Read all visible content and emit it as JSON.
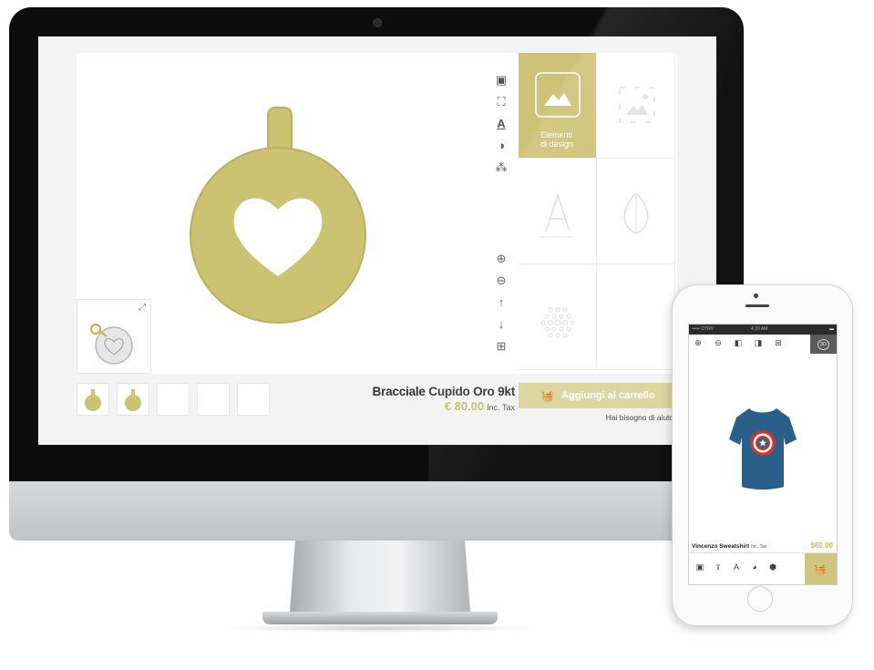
{
  "desktop": {
    "toolbar_top": [
      {
        "name": "image-icon",
        "glyph": "▣"
      },
      {
        "name": "crop-image-icon",
        "glyph": "⛶"
      },
      {
        "name": "text-icon",
        "glyph": "A̲"
      },
      {
        "name": "contrast-icon",
        "glyph": "◑"
      },
      {
        "name": "pattern-icon",
        "glyph": "⁂"
      }
    ],
    "toolbar_bottom": [
      {
        "name": "zoom-in-icon",
        "glyph": "⊕"
      },
      {
        "name": "zoom-out-icon",
        "glyph": "⊖"
      },
      {
        "name": "arrow-up-icon",
        "glyph": "↑"
      },
      {
        "name": "arrow-down-icon",
        "glyph": "↓"
      },
      {
        "name": "grid-icon",
        "glyph": "⊞"
      }
    ],
    "panel": {
      "active_label_line1": "Elementi",
      "active_label_line2": "di design"
    },
    "product": {
      "name": "Bracciale Cupido Oro 9kt",
      "price": "€ 80.00",
      "tax_note": "Inc. Tax"
    },
    "cart_button": "Aggiungi al carrello",
    "help_link": "Hai bisogno di aiuto?",
    "colors": {
      "accent": "#cdc276",
      "accent_light": "#ddd59e",
      "pendant_gold": "#cbc272",
      "price_gold": "#c7bc63"
    }
  },
  "mobile": {
    "status": {
      "carrier": "••••• OTRV",
      "time": "4:20 AM"
    },
    "toolbar_3d": "3D",
    "product": {
      "name": "Vincenzo Sweatshirt",
      "tax_note": "Inc. Tax",
      "price": "$60.00"
    },
    "shirt_color": "#2a5f8a"
  }
}
